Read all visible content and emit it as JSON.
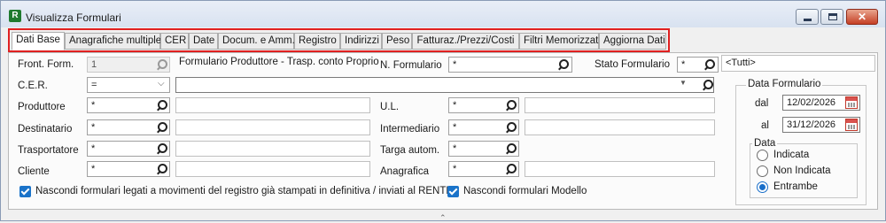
{
  "window": {
    "title": "Visualizza Formulari",
    "icon_letter": "R",
    "controls": {
      "minimize": "minimize-icon",
      "maximize": "maximize-icon",
      "close": "close-icon"
    }
  },
  "tabs": [
    {
      "label": "Dati Base",
      "active": true
    },
    {
      "label": "Anagrafiche multiple"
    },
    {
      "label": "CER"
    },
    {
      "label": "Date"
    },
    {
      "label": "Docum. e Amm."
    },
    {
      "label": "Registro"
    },
    {
      "label": "Indirizzi"
    },
    {
      "label": "Peso"
    },
    {
      "label": "Fatturaz./Prezzi/Costi"
    },
    {
      "label": "Filtri Memorizzati"
    },
    {
      "label": "Aggiorna Dati"
    }
  ],
  "form": {
    "front_form": {
      "label": "Front. Form.",
      "value": "1",
      "description": "Formulario Produttore - Trasp. conto Proprio"
    },
    "n_formulario": {
      "label": "N. Formulario",
      "value": "*"
    },
    "stato_formulario": {
      "label": "Stato Formulario",
      "value": "*",
      "description": "<Tutti>"
    },
    "cer": {
      "label": "C.E.R.",
      "operator": "="
    },
    "produttore": {
      "label": "Produttore",
      "value": "*"
    },
    "destinatario": {
      "label": "Destinatario",
      "value": "*"
    },
    "trasportatore": {
      "label": "Trasportatore",
      "value": "*"
    },
    "cliente": {
      "label": "Cliente",
      "value": "*"
    },
    "ul": {
      "label": "U.L.",
      "value": "*"
    },
    "intermediario": {
      "label": "Intermediario",
      "value": "*"
    },
    "targa": {
      "label": "Targa autom.",
      "value": "*"
    },
    "anagrafica": {
      "label": "Anagrafica",
      "value": "*"
    },
    "check_rentri": {
      "label": "Nascondi formulari legati a movimenti del registro già stampati in definitiva / inviati al RENTRI",
      "checked": true
    },
    "check_modello": {
      "label": "Nascondi formulari Modello",
      "checked": true
    }
  },
  "data_formulario": {
    "title": "Data Formulario",
    "dal_label": "dal",
    "dal_value": "12/02/2026",
    "al_label": "al",
    "al_value": "31/12/2026",
    "data_group": {
      "title": "Data",
      "options": [
        "Indicata",
        "Non Indicata",
        "Entrambe"
      ],
      "selected": "Entrambe"
    }
  },
  "colors": {
    "highlight_border": "#e02020",
    "checkbox_accent": "#1a73c9"
  }
}
